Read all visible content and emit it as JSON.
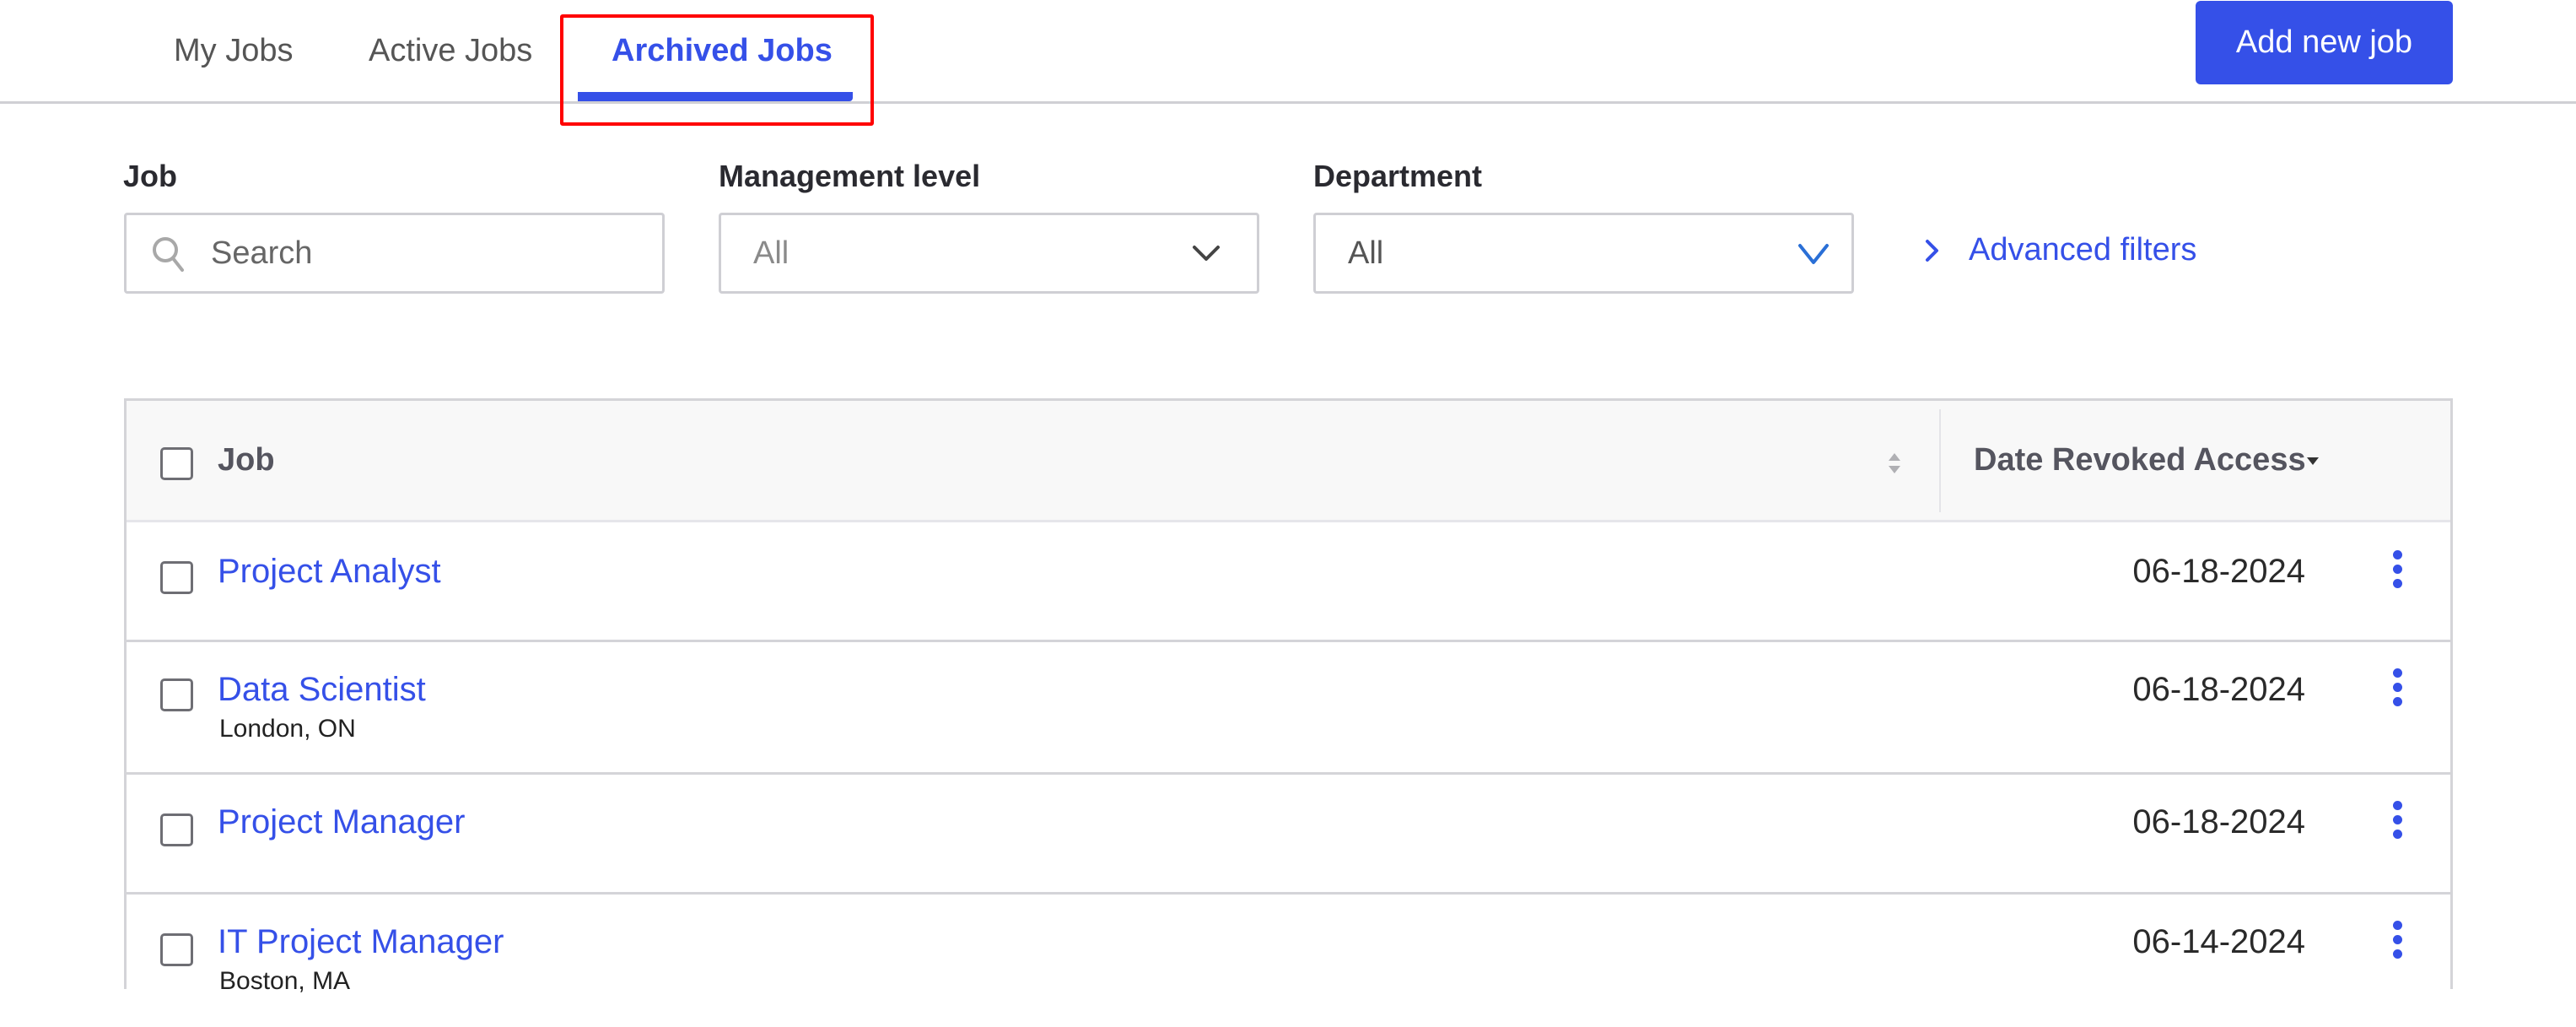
{
  "tabs": [
    {
      "label": "My Jobs",
      "active": false
    },
    {
      "label": "Active Jobs",
      "active": false
    },
    {
      "label": "Archived Jobs",
      "active": true
    }
  ],
  "header": {
    "add_button_label": "Add new job"
  },
  "filters": {
    "job": {
      "label": "Job",
      "placeholder": "Search",
      "value": ""
    },
    "management_level": {
      "label": "Management level",
      "value": "All"
    },
    "department": {
      "label": "Department",
      "value": "All"
    },
    "advanced_filters_label": "Advanced filters"
  },
  "table": {
    "columns": [
      {
        "label": "Job",
        "sort": "none"
      },
      {
        "label": "Date Revoked Access",
        "sort": "descending"
      }
    ],
    "rows": [
      {
        "job": "Project Analyst",
        "location": "",
        "date": "06-18-2024"
      },
      {
        "job": "Data Scientist",
        "location": "London, ON",
        "date": "06-18-2024"
      },
      {
        "job": "Project Manager",
        "location": "",
        "date": "06-18-2024"
      },
      {
        "job": "IT Project Manager",
        "location": "Boston, MA",
        "date": "06-14-2024"
      }
    ]
  },
  "colors": {
    "accent": "#3550e8",
    "highlight": "#ff0000"
  }
}
